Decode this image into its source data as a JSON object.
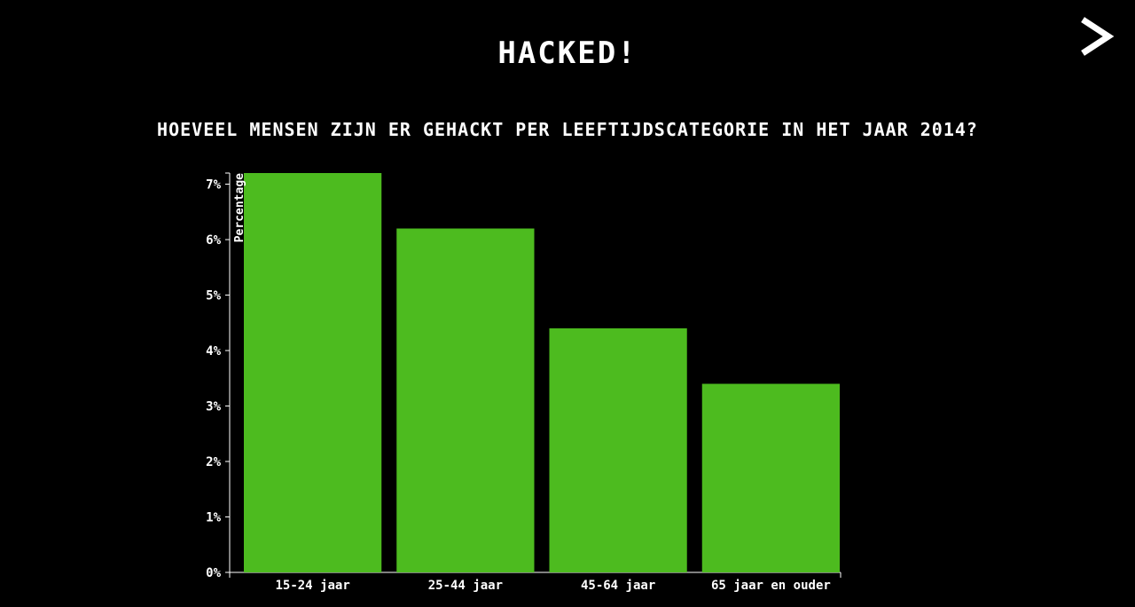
{
  "header": {
    "title": "HACKED!"
  },
  "navigation": {
    "next_icon": "chevron-right-icon"
  },
  "chart_data": {
    "type": "bar",
    "title": "HOEVEEL MENSEN ZIJN ER GEHACKT PER LEEFTIJDSCATEGORIE IN HET JAAR 2014?",
    "xlabel": "",
    "ylabel": "Percentage",
    "categories": [
      "15-24 jaar",
      "25-44 jaar",
      "45-64 jaar",
      "65 jaar en ouder"
    ],
    "values": [
      7.2,
      6.2,
      4.4,
      3.4
    ],
    "ylim": [
      0,
      7.2
    ],
    "yticks": [
      0,
      1,
      2,
      3,
      4,
      5,
      6,
      7
    ],
    "ytick_labels": [
      "0%",
      "1%",
      "2%",
      "3%",
      "4%",
      "5%",
      "6%",
      "7%"
    ],
    "grid": false,
    "bar_color": "#4dbb1f",
    "axis_color": "#ffffff",
    "background_color": "#000000"
  }
}
